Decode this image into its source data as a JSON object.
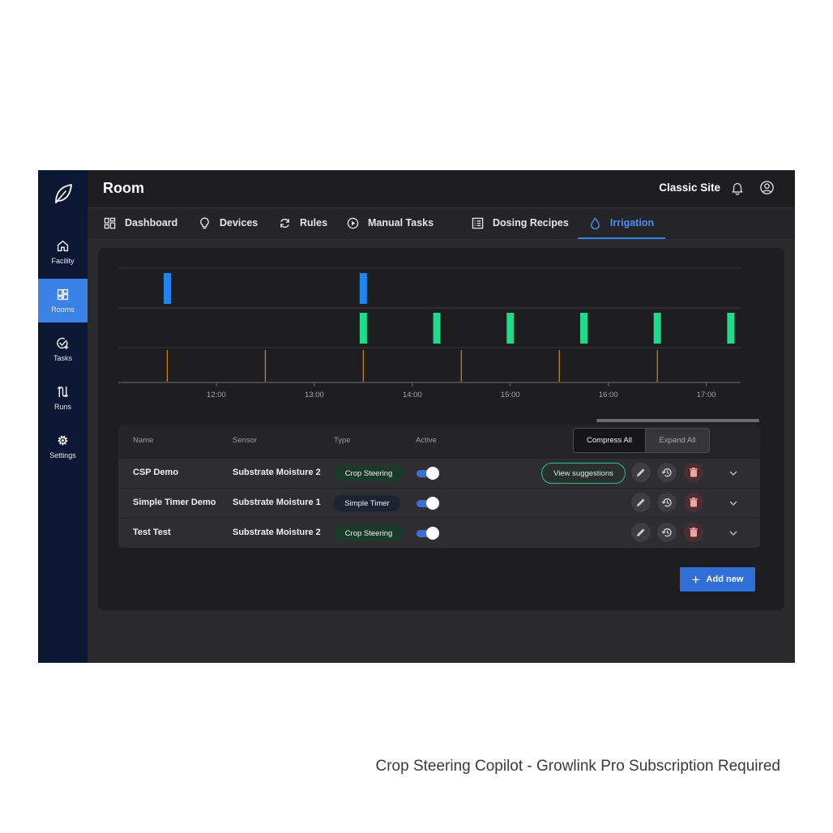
{
  "colors": {
    "sidebar_bg": "#0b1733",
    "accent": "#3b82e6",
    "bar_blue": "#1f86f0",
    "bar_green": "#1fdc8a",
    "line_orange": "#c8892c"
  },
  "header": {
    "title": "Room",
    "site": "Classic Site",
    "icons": [
      "bell-icon",
      "user-icon"
    ]
  },
  "sidebar": {
    "logo": "leaf-logo",
    "items": [
      {
        "label": "Facility",
        "icon": "home-icon"
      },
      {
        "label": "Rooms",
        "icon": "grid-icon",
        "active": true
      },
      {
        "label": "Tasks",
        "icon": "task-check-icon"
      },
      {
        "label": "Runs",
        "icon": "route-icon"
      },
      {
        "label": "Settings",
        "icon": "gear-icon"
      }
    ]
  },
  "tabs": [
    {
      "label": "Dashboard",
      "icon": "dashboard-icon"
    },
    {
      "label": "Devices",
      "icon": "lightbulb-icon"
    },
    {
      "label": "Rules",
      "icon": "refresh-icon"
    },
    {
      "label": "Manual Tasks",
      "icon": "play-icon"
    },
    {
      "label": "Dosing Recipes",
      "icon": "list-icon"
    },
    {
      "label": "Irrigation",
      "icon": "droplet-icon",
      "active": true
    }
  ],
  "timeline": {
    "ticks": [
      "12:00",
      "13:00",
      "14:00",
      "15:00",
      "16:00",
      "17:00"
    ],
    "tick_hours": [
      12,
      13,
      14,
      15,
      16,
      17
    ],
    "range_hours": [
      11,
      17.35
    ],
    "lanes": [
      {
        "color": "#1f86f0",
        "events": [
          11.5,
          13.5
        ]
      },
      {
        "color": "#1fdc8a",
        "events": [
          13.5,
          14.25,
          15.0,
          15.75,
          16.5,
          17.25
        ]
      },
      {
        "color": "#c8892c",
        "events": [
          11.5,
          12.5,
          13.5,
          14.5,
          15.5,
          16.5
        ]
      }
    ]
  },
  "table": {
    "columns": {
      "name": "Name",
      "sensor": "Sensor",
      "type": "Type",
      "active": "Active"
    },
    "compress_label": "Compress All",
    "expand_label": "Expand All",
    "suggestions_label": "View suggestions",
    "rows": [
      {
        "name": "CSP Demo",
        "sensor": "Substrate Moisture 2",
        "type": "Crop Steering",
        "active": true,
        "suggestions": true
      },
      {
        "name": "Simple Timer Demo",
        "sensor": "Substrate Moisture 1",
        "type": "Simple Timer",
        "active": true,
        "suggestions": false
      },
      {
        "name": "Test Test",
        "sensor": "Substrate Moisture 2",
        "type": "Crop Steering",
        "active": true,
        "suggestions": false
      }
    ]
  },
  "add_button": "Add new",
  "caption": "Crop Steering Copilot - Growlink Pro Subscription Required"
}
